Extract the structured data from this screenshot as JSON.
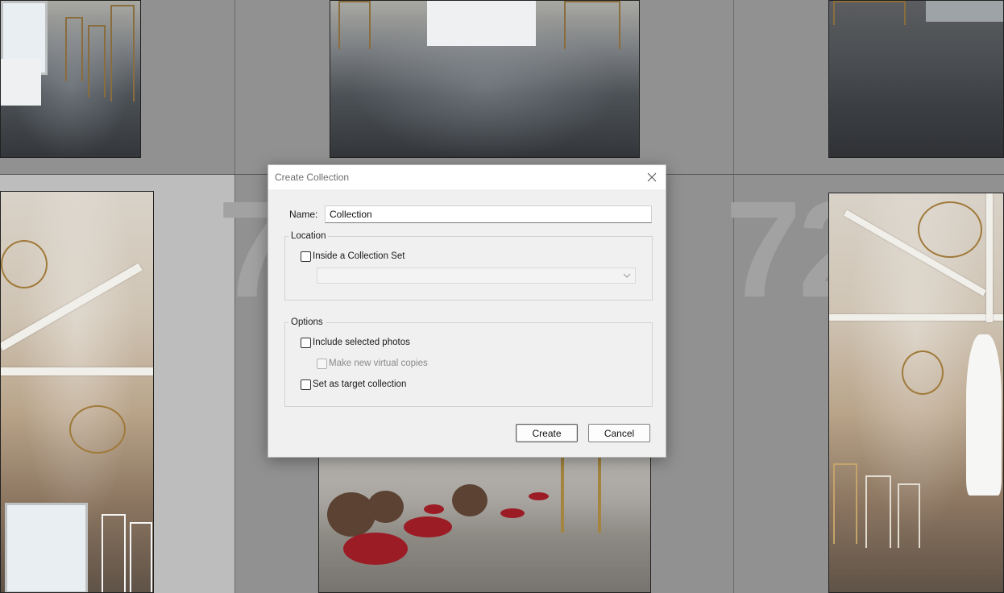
{
  "background": {
    "grid_index_labels": [
      "7",
      "72"
    ]
  },
  "dialog": {
    "title": "Create Collection",
    "name_label": "Name:",
    "name_value": "Collection",
    "location": {
      "title": "Location",
      "inside_collection_set_label": "Inside a Collection Set",
      "inside_collection_set_checked": false,
      "collection_set_value": ""
    },
    "options": {
      "title": "Options",
      "include_selected_label": "Include selected photos",
      "include_selected_checked": false,
      "make_virtual_copies_label": "Make new virtual copies",
      "make_virtual_copies_checked": false,
      "make_virtual_copies_enabled": false,
      "set_target_label": "Set as target collection",
      "set_target_checked": false
    },
    "create_label": "Create",
    "cancel_label": "Cancel"
  },
  "icons": {
    "close": "close-icon",
    "dropdown": "chevron-down-icon"
  }
}
